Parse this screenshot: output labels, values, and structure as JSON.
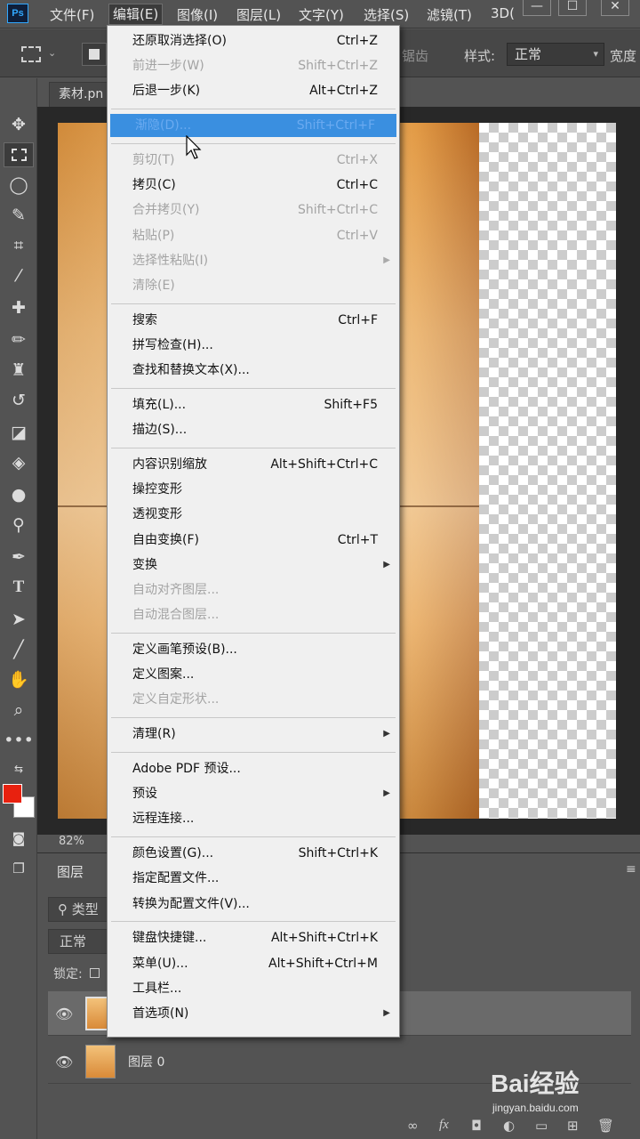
{
  "menubar": {
    "logo": "Ps",
    "items": [
      "文件(F)",
      "编辑(E)",
      "图像(I)",
      "图层(L)",
      "文字(Y)",
      "选择(S)",
      "滤镜(T)",
      "3D("
    ],
    "window_buttons": [
      "—",
      "☐",
      "✕"
    ]
  },
  "options": {
    "feather_text": "锯齿",
    "style_label": "样式:",
    "style_value": "正常",
    "width_label": "宽度"
  },
  "document": {
    "tab_title": "素材.pn",
    "zoom": "82%"
  },
  "edit_menu": {
    "sections": [
      [
        {
          "label": "还原取消选择(O)",
          "shortcut": "Ctrl+Z",
          "enabled": true
        },
        {
          "label": "前进一步(W)",
          "shortcut": "Shift+Ctrl+Z",
          "enabled": false
        },
        {
          "label": "后退一步(K)",
          "shortcut": "Alt+Ctrl+Z",
          "enabled": true
        }
      ],
      [
        {
          "label": "渐隐(D)...",
          "shortcut": "Shift+Ctrl+F",
          "enabled": true,
          "highlighted": true
        }
      ],
      [
        {
          "label": "剪切(T)",
          "shortcut": "Ctrl+X",
          "enabled": false
        },
        {
          "label": "拷贝(C)",
          "shortcut": "Ctrl+C",
          "enabled": true
        },
        {
          "label": "合并拷贝(Y)",
          "shortcut": "Shift+Ctrl+C",
          "enabled": false
        },
        {
          "label": "粘贴(P)",
          "shortcut": "Ctrl+V",
          "enabled": false
        },
        {
          "label": "选择性粘贴(I)",
          "shortcut": "",
          "enabled": false,
          "submenu": true
        },
        {
          "label": "清除(E)",
          "shortcut": "",
          "enabled": false
        }
      ],
      [
        {
          "label": "搜索",
          "shortcut": "Ctrl+F",
          "enabled": true
        },
        {
          "label": "拼写检查(H)...",
          "shortcut": "",
          "enabled": true
        },
        {
          "label": "查找和替换文本(X)...",
          "shortcut": "",
          "enabled": true
        }
      ],
      [
        {
          "label": "填充(L)...",
          "shortcut": "Shift+F5",
          "enabled": true
        },
        {
          "label": "描边(S)...",
          "shortcut": "",
          "enabled": true
        }
      ],
      [
        {
          "label": "内容识别缩放",
          "shortcut": "Alt+Shift+Ctrl+C",
          "enabled": true
        },
        {
          "label": "操控变形",
          "shortcut": "",
          "enabled": true
        },
        {
          "label": "透视变形",
          "shortcut": "",
          "enabled": true
        },
        {
          "label": "自由变换(F)",
          "shortcut": "Ctrl+T",
          "enabled": true
        },
        {
          "label": "变换",
          "shortcut": "",
          "enabled": true,
          "submenu": true
        },
        {
          "label": "自动对齐图层...",
          "shortcut": "",
          "enabled": false
        },
        {
          "label": "自动混合图层...",
          "shortcut": "",
          "enabled": false
        }
      ],
      [
        {
          "label": "定义画笔预设(B)...",
          "shortcut": "",
          "enabled": true
        },
        {
          "label": "定义图案...",
          "shortcut": "",
          "enabled": true
        },
        {
          "label": "定义自定形状...",
          "shortcut": "",
          "enabled": false
        }
      ],
      [
        {
          "label": "清理(R)",
          "shortcut": "",
          "enabled": true,
          "submenu": true
        }
      ],
      [
        {
          "label": "Adobe PDF 预设...",
          "shortcut": "",
          "enabled": true
        },
        {
          "label": "预设",
          "shortcut": "",
          "enabled": true,
          "submenu": true
        },
        {
          "label": "远程连接...",
          "shortcut": "",
          "enabled": true
        }
      ],
      [
        {
          "label": "颜色设置(G)...",
          "shortcut": "Shift+Ctrl+K",
          "enabled": true
        },
        {
          "label": "指定配置文件...",
          "shortcut": "",
          "enabled": true
        },
        {
          "label": "转换为配置文件(V)...",
          "shortcut": "",
          "enabled": true
        }
      ],
      [
        {
          "label": "键盘快捷键...",
          "shortcut": "Alt+Shift+Ctrl+K",
          "enabled": true
        },
        {
          "label": "菜单(U)...",
          "shortcut": "Alt+Shift+Ctrl+M",
          "enabled": true
        },
        {
          "label": "工具栏...",
          "shortcut": "",
          "enabled": true
        },
        {
          "label": "首选项(N)",
          "shortcut": "",
          "enabled": true,
          "submenu": true
        }
      ]
    ]
  },
  "layers": {
    "tab_label": "图层",
    "filter_label": "类型",
    "blend_mode": "正常",
    "lock_label": "锁定:",
    "rows": [
      {
        "name": "",
        "selected": true
      },
      {
        "name": "图层 0",
        "selected": false
      }
    ]
  },
  "watermark": {
    "logo": "Bai经验",
    "url": "jingyan.baidu.com"
  },
  "colors": {
    "foreground": "#e8210f",
    "background": "#ffffff",
    "menu_highlight": "#3a8fe0"
  }
}
